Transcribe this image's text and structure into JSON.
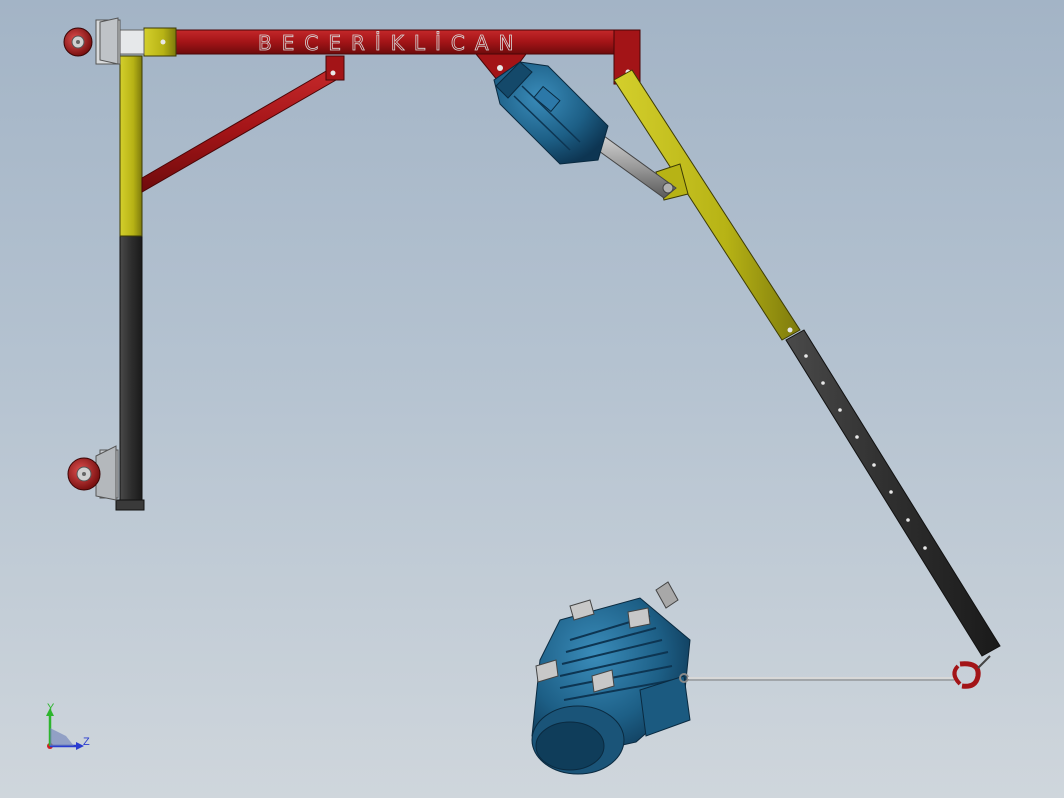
{
  "viewport": {
    "background_top": "#a3b4c6",
    "background_bottom": "#cfd6dc"
  },
  "model": {
    "brand_text": "BECERİKLİCAN",
    "colors": {
      "frame_red": "#a31417",
      "frame_yellow": "#b7b315",
      "frame_black": "#2e2e2e",
      "motor_blue": "#1d5f86",
      "cylinder_grey": "#9a9a9a",
      "cable_grey": "#d8d8d8"
    }
  },
  "triad": {
    "y_label": "Y",
    "z_label": "Z",
    "y_color": "#2db52d",
    "z_color": "#2a3cd0",
    "x_color": "#d02020"
  }
}
